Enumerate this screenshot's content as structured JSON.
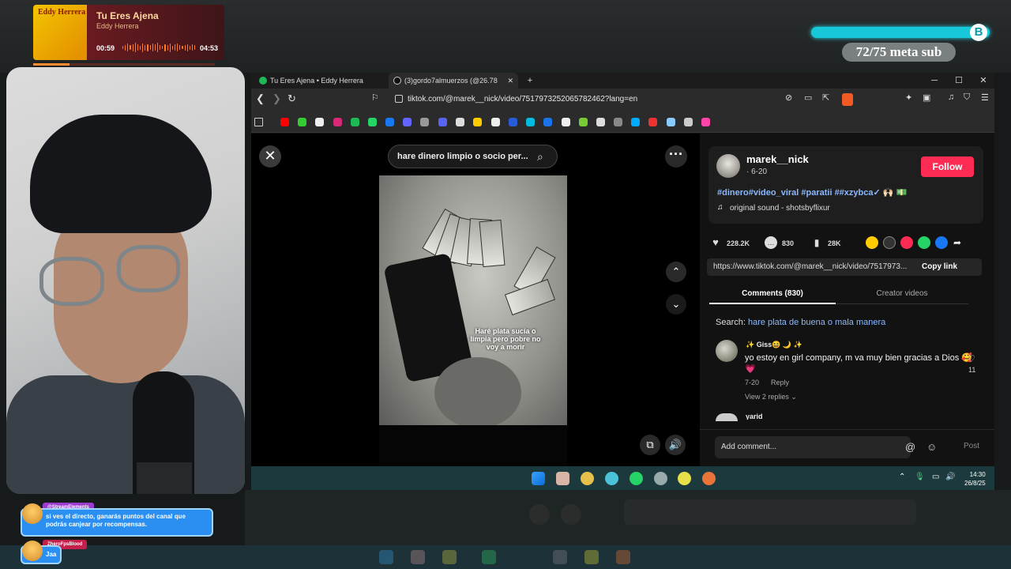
{
  "now_playing": {
    "title": "Tu Eres Ajena",
    "artist": "Eddy Herrera",
    "cover_text": "Eddy Herrera",
    "elapsed": "00:59",
    "duration": "04:53",
    "progress": 0.2
  },
  "goal": {
    "text": "72/75 meta sub",
    "badge": "B",
    "progress": 0.96
  },
  "chat": [
    {
      "user": "@StreamElements",
      "message": "si ves el directo, ganarás puntos del canal que podrás canjear por recompensas."
    },
    {
      "user": "ZheroFpsBlood",
      "message": "Jaa"
    }
  ],
  "browser": {
    "tabs": [
      {
        "label": "Tu Eres Ajena • Eddy Herrera"
      },
      {
        "label": "(3)gordo7almuerzos (@26.78"
      }
    ],
    "url": "tiktok.com/@marek__nick/video/7517973252065782462?lang=en",
    "win_min": "─",
    "win_max": "☐",
    "win_close": "✕",
    "new_tab": "+"
  },
  "tiktok": {
    "search_text": "hare dinero limpio o socio per...",
    "video_caption": "Haré plata sucia o limpia pero pobre no voy a morir",
    "author": {
      "username": "marek__nick",
      "date": "· 6-20"
    },
    "follow_label": "Follow",
    "hashtags": "#dinero#video_viral #paratii ##xzybca✓ 🙌🏻 💵",
    "sound": "original sound - shotsbyflixur",
    "stats": {
      "likes": "228.2K",
      "comments": "830",
      "saves": "28K"
    },
    "link": "https://www.tiktok.com/@marek__nick/video/7517973...",
    "copy_link_label": "Copy link",
    "tab_comments": "Comments (830)",
    "tab_creator": "Creator videos",
    "search_label": "Search:",
    "search_query": "hare plata de buena o mala manera",
    "comment": {
      "user": "✨ Giss😆 🌙 ✨",
      "text": "yo estoy en girl company, m va muy bien gracias a Dios 🥰 💗",
      "date": "7-20",
      "reply": "Reply",
      "view_replies": "View 2 replies ⌄",
      "likes": "11"
    },
    "comment2_user": "yarid",
    "add_comment": "Add comment...",
    "post_label": "Post"
  },
  "taskbar": {
    "time": "14:30",
    "date": "26/8/25"
  },
  "colors": {
    "tiktok_red": "#fe2c55",
    "goal_cyan": "#16c8d8",
    "hashtag_blue": "#8bb8ff"
  }
}
